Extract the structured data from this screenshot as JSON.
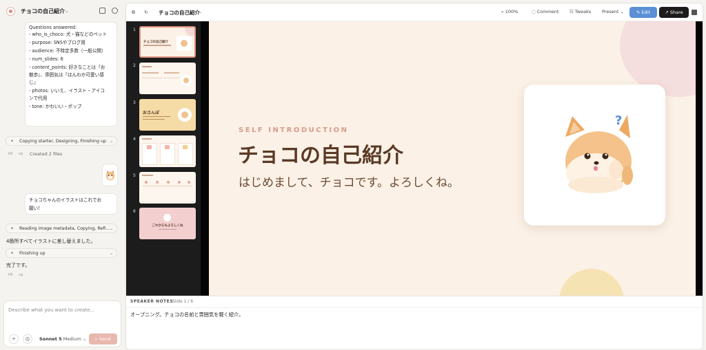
{
  "sidebar": {
    "project_title": "チョコの自己紹介",
    "qa_lines": [
      "Questions answered:",
      "- who_is_choco: 犬・猫などのペット",
      "- purpose: SNSやブログ用",
      "- audience: 不特定多数（一般公開）",
      "- num_slides: 6",
      "- content_points: 好きなことは『お",
      "散歩』、雰囲気は『ほんわか可愛い感",
      "じ』",
      "- photos: いいえ、イラスト・アイコ",
      "ンで代用",
      "- tone: かわいい・ポップ"
    ],
    "activity1": "Copying starter, Designing, Finishing up",
    "created": "Created 2 files",
    "user_message": [
      "チョコちゃんのイラストはこれでお",
      "願い！"
    ],
    "activity2": "Reading image metadata, Copying, Refi...",
    "reply1": "4箇所すべてイラストに差し替えました。",
    "activity3": "Finishing up",
    "reply2": "完了です。",
    "composer_placeholder": "Describe what you want to create...",
    "model_name": "Sonnet 5",
    "model_effort": "Medium",
    "send_label": "Send"
  },
  "toolbar": {
    "doc_title": "チョコの自己紹介",
    "zoom": "100%",
    "comment": "Comment",
    "tweaks": "Tweaks",
    "present": "Present",
    "edit": "Edit",
    "share": "Share"
  },
  "slides": {
    "numbers": [
      "1",
      "2",
      "3",
      "4",
      "5",
      "6"
    ],
    "thumb1_title": "チョコの自己紹介",
    "thumb3_title": "おさんぽ",
    "thumb6_title": "これからもよろしくね"
  },
  "slide": {
    "kicker": "SELF INTRODUCTION",
    "title": "チョコの自己紹介",
    "subtitle": "はじめまして、チョコです。よろしくね。",
    "question_mark": "?"
  },
  "notes": {
    "label": "SPEAKER NOTES",
    "count": "Slide 1 / 6",
    "text": "オープニング。チョコの名前と雰囲気を軽く紹介。"
  },
  "colors": {
    "accent_blue": "#5b8fd6",
    "slide_bg": "#fbf1e6",
    "title_brown": "#5a3a26",
    "kicker_pink": "#d99a8c",
    "send_pink": "#e8b8ae"
  }
}
